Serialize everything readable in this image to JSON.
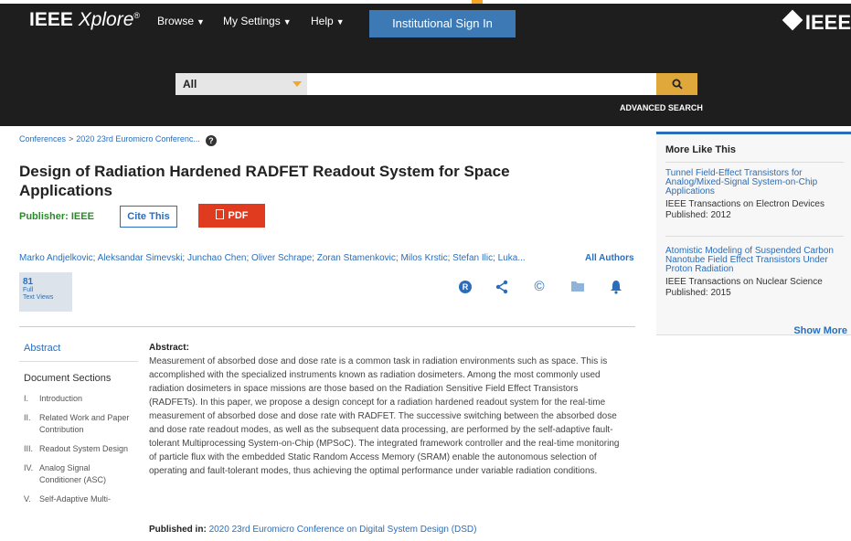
{
  "header": {
    "logo_text": "IEEE",
    "logo_italic": "Xplore",
    "logo_reg": "®",
    "nav": [
      {
        "label": "Browse"
      },
      {
        "label": "My Settings"
      },
      {
        "label": "Help"
      }
    ],
    "signin_label": "Institutional Sign In",
    "ieee_mark": "IEEE"
  },
  "search": {
    "scope_value": "All",
    "input_value": "",
    "search_icon": "search-icon",
    "advanced_label": "ADVANCED SEARCH"
  },
  "breadcrumb": [
    "Conferences",
    "2020 23rd Euromicro Conferenc..."
  ],
  "breadcrumb_sep": ">",
  "article": {
    "title": "Design of Radiation Hardened RADFET Readout System for Space Applications",
    "publisher_label": "Publisher: IEEE",
    "cite_label": "Cite This",
    "pdf_label": "PDF",
    "authors": [
      "Marko Andjelkovic",
      "Aleksandar Simevski",
      "Junchao Chen",
      "Oliver Schrape",
      "Zoran Stamenkovic",
      "Milos Krstic",
      "Stefan Ilic",
      "Luka..."
    ],
    "author_sep": ";",
    "all_authors_label": "All Authors",
    "metrics": {
      "count": "81",
      "label_line1": "Full",
      "label_line2": "Text Views"
    },
    "actions": [
      "rights-icon",
      "share-icon",
      "copyright-icon",
      "folder-icon",
      "bell-icon"
    ]
  },
  "left_nav": {
    "abstract_tab": "Abstract",
    "sections_head": "Document Sections",
    "sections": [
      {
        "num": "I.",
        "label": "Introduction"
      },
      {
        "num": "II.",
        "label": "Related Work and Paper Contribution"
      },
      {
        "num": "III.",
        "label": "Readout System Design"
      },
      {
        "num": "IV.",
        "label": "Analog Signal Conditioner (ASC)"
      },
      {
        "num": "V.",
        "label": "Self-Adaptive Multi-"
      }
    ]
  },
  "abstract": {
    "heading": "Abstract:",
    "text": "Measurement of absorbed dose and dose rate is a common task in radiation environments such as space. This is accomplished with the specialized instruments known as radiation dosimeters. Among the most commonly used radiation dosimeters in space missions are those based on the Radiation Sensitive Field Effect Transistors (RADFETs). In this paper, we propose a design concept for a radiation hardened readout system for the real-time measurement of absorbed dose and dose rate with RADFET. The successive switching between the absorbed dose and dose rate readout modes, as well as the subsequent data processing, are performed by the self-adaptive fault-tolerant Multiprocessing System-on-Chip (MPSoC). The integrated framework controller and the real-time monitoring of particle flux with the embedded Static Random Access Memory (SRAM) enable the autonomous selection of operating and fault-tolerant modes, thus achieving the optimal performance under variable radiation conditions.",
    "published_label": "Published in:",
    "published_value": "2020 23rd Euromicro Conference on Digital System Design (DSD)"
  },
  "more_like_this": {
    "heading": "More Like This",
    "items": [
      {
        "title": "Tunnel Field-Effect Transistors for Analog/Mixed-Signal System-on-Chip Applications",
        "journal": "IEEE Transactions on Electron Devices",
        "published": "Published: 2012"
      },
      {
        "title": "Atomistic Modeling of Suspended Carbon Nanotube Field Effect Transistors Under Proton Radiation",
        "journal": "IEEE Transactions on Nuclear Science",
        "published": "Published: 2015"
      }
    ],
    "show_more": "Show More"
  },
  "colors": {
    "header_bg": "#1e1e1e",
    "link": "#2a6ebb",
    "pdf": "#e03b1f",
    "publisher": "#2a8a2a",
    "accent": "#f5a623"
  }
}
